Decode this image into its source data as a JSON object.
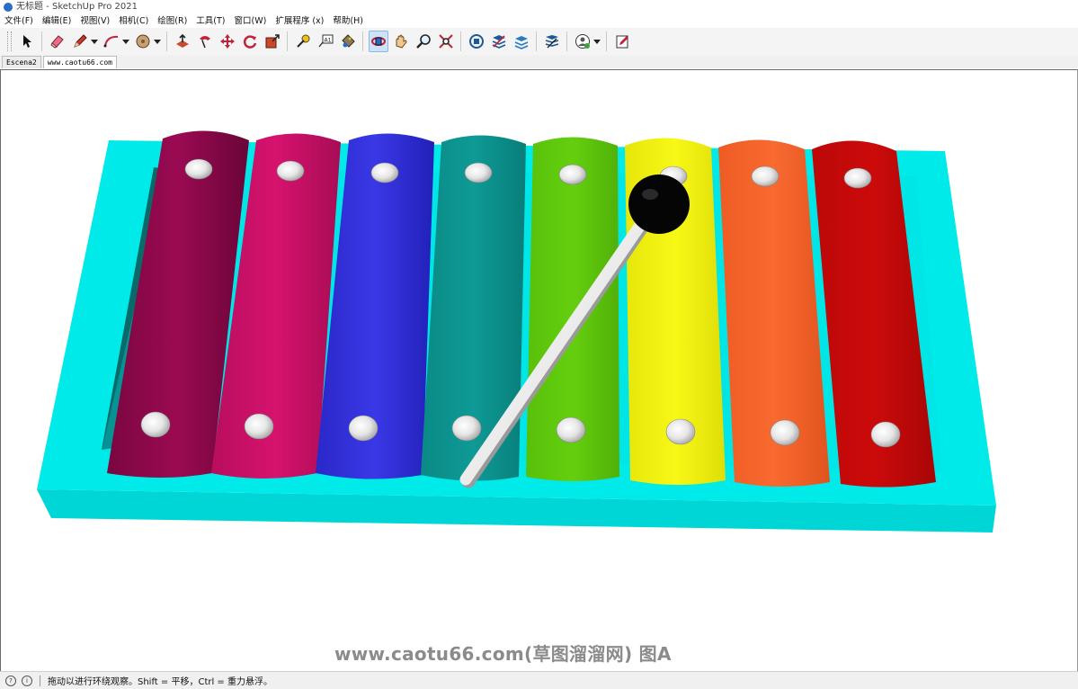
{
  "window": {
    "title": "无标题 - SketchUp Pro 2021"
  },
  "menu": [
    "文件(F)",
    "编辑(E)",
    "视图(V)",
    "相机(C)",
    "绘图(R)",
    "工具(T)",
    "窗口(W)",
    "扩展程序 (x)",
    "帮助(H)"
  ],
  "toolbar": {
    "icons": [
      "select-icon",
      "eraser-icon",
      "pencil-icon",
      "arc-icon",
      "shape-icon",
      "push-pull-icon",
      "follow-me-icon",
      "move-icon",
      "rotate-icon",
      "scale-icon",
      "tape-measure-icon",
      "text-icon",
      "paint-bucket-icon",
      "orbit-icon",
      "pan-icon",
      "zoom-icon",
      "zoom-extents-icon",
      "warehouse-icon",
      "extension-warehouse-icon",
      "layout-icon",
      "sandbox-icon",
      "profile-icon",
      "edit-icon"
    ],
    "active_tool": "orbit-icon"
  },
  "scene_tabs": [
    "Escena2",
    "www.caotu66.com"
  ],
  "viewport": {
    "watermark": "www.caotu66.com(草图溜溜网) 图A",
    "colors": {
      "base": "#00e8e8",
      "bars": [
        "#9a0a52",
        "#d6126e",
        "#3a38e6",
        "#0e9a96",
        "#64cf0e",
        "#f4f40e",
        "#f86a30",
        "#cc0a0a"
      ],
      "mallet_head": "#050505",
      "mallet_stick": "#f4f4f4"
    }
  },
  "status": {
    "text": "拖动以进行环绕观察。Shift = 平移，Ctrl = 重力悬浮。"
  }
}
